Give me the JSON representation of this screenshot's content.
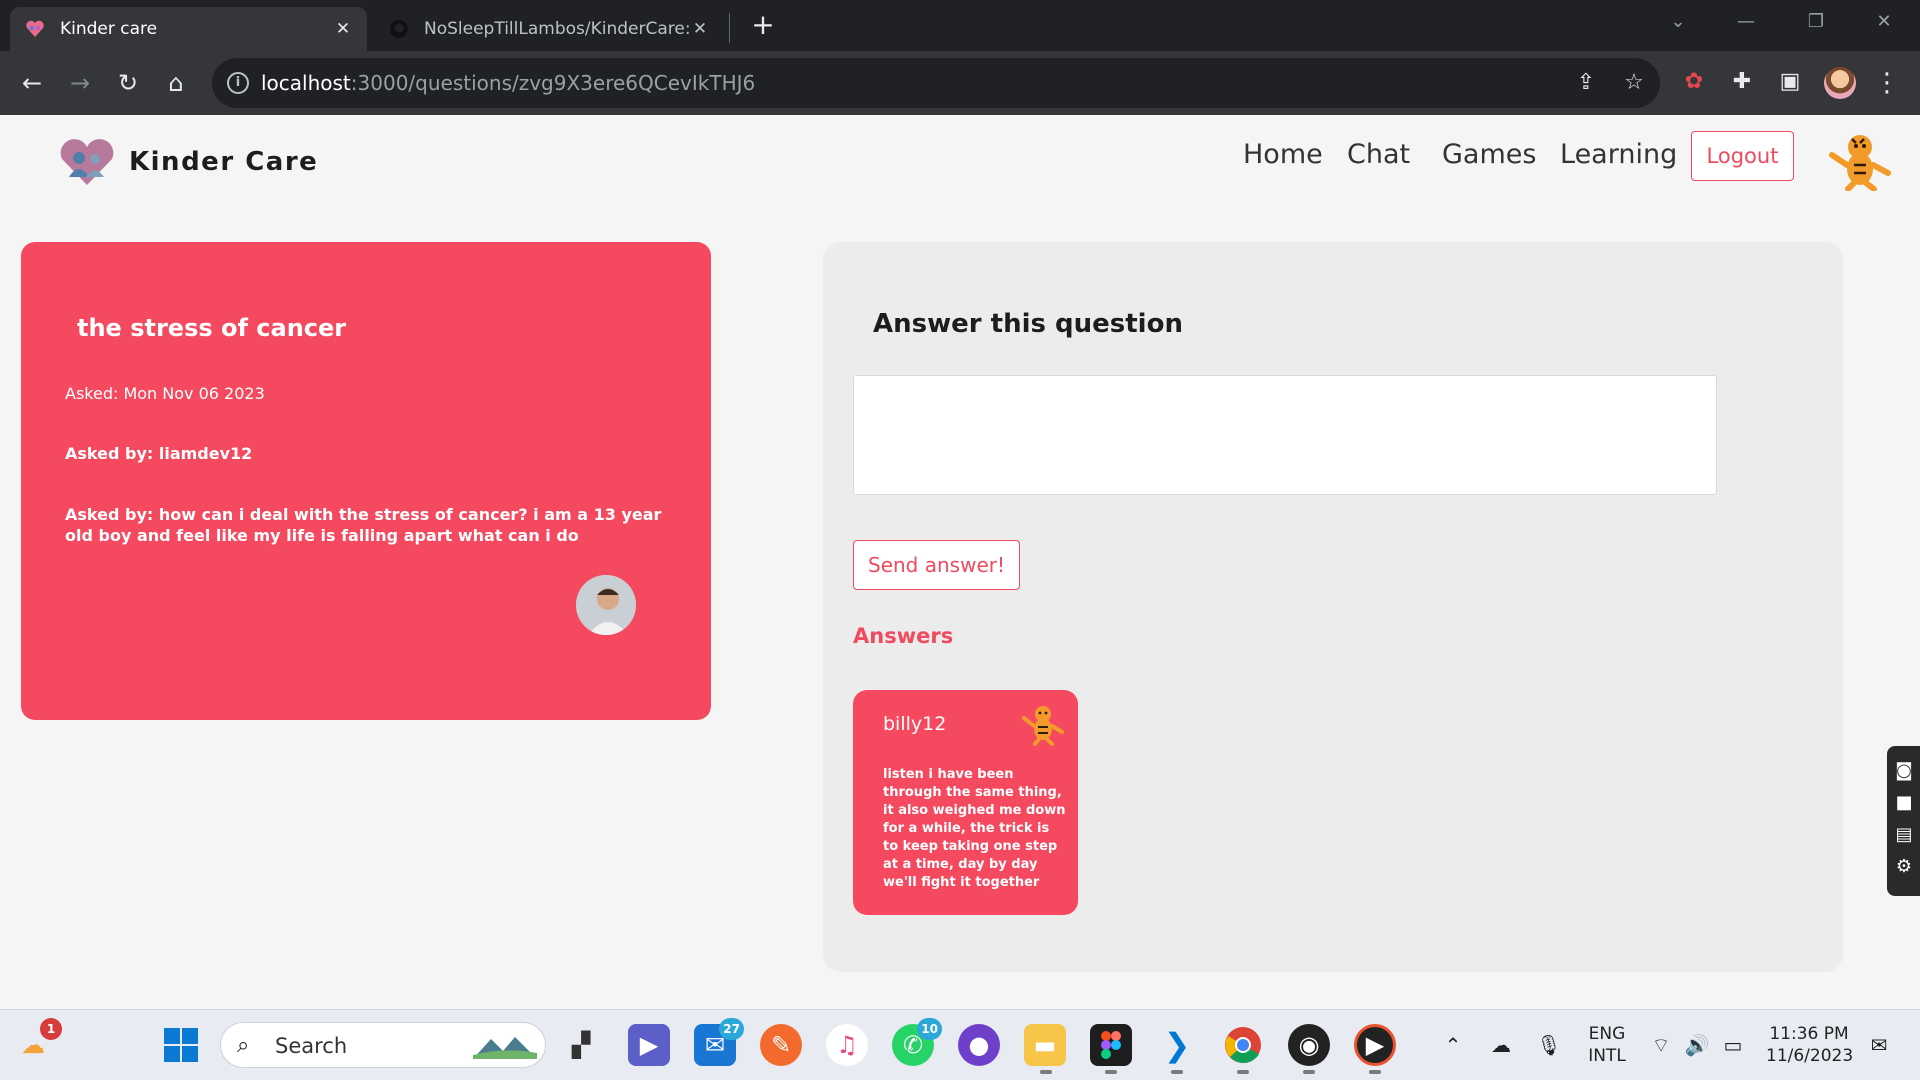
{
  "browser": {
    "tabs": [
      {
        "title": "Kinder care",
        "active": true
      },
      {
        "title": "NoSleepTillLambos/KinderCare:",
        "active": false
      }
    ],
    "url_host": "localhost",
    "url_path": ":3000/questions/zvg9X3ere6QCevIkTHJ6"
  },
  "navbar": {
    "brand": "Kinder Care",
    "links": [
      "Home",
      "Chat",
      "Games",
      "Learning"
    ],
    "logout_label": "Logout"
  },
  "question": {
    "title": "the stress of cancer",
    "asked_date": "Asked: Mon Nov 06 2023",
    "asked_by": "Asked by: liamdev12",
    "body": "Asked by: how can i deal with the stress of cancer? i am a 13 year old boy and feel like my life is falling apart what can i do"
  },
  "answer_form": {
    "heading": "Answer this question",
    "input_value": "",
    "input_placeholder": "",
    "send_label": "Send answer!"
  },
  "answers": {
    "heading": "Answers",
    "items": [
      {
        "username": "billy12",
        "text": "listen i have been through the same thing, it also weighed me down for a while, the trick is to keep taking one step at a time, day by day we'll fight it together"
      }
    ]
  },
  "taskbar": {
    "search_label": "Search",
    "weather_badge": "1",
    "mail_badge": "27",
    "whatsapp_badge": "10",
    "lang_line1": "ENG",
    "lang_line2": "INTL",
    "time": "11:36 PM",
    "date": "11/6/2023"
  },
  "colors": {
    "accent": "#f4495f",
    "chrome_dark": "#202124",
    "chrome_toolbar": "#35363a"
  }
}
